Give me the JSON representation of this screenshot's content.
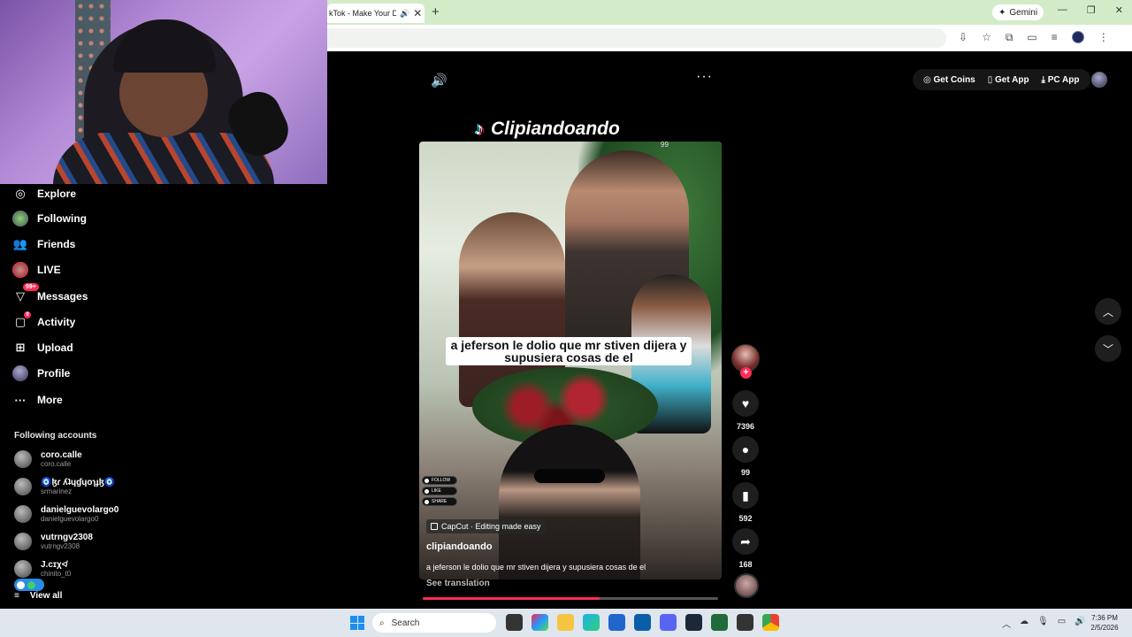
{
  "browser": {
    "tab_title": "kTok - Make Your Da",
    "gemini_label": "Gemini"
  },
  "topbar": {
    "get_coins": "Get Coins",
    "get_app": "Get App",
    "pc_app": "PC App"
  },
  "sidebar": {
    "items": [
      {
        "label": "Explore"
      },
      {
        "label": "Following"
      },
      {
        "label": "Friends"
      },
      {
        "label": "LIVE"
      },
      {
        "label": "Messages",
        "badge": "99+"
      },
      {
        "label": "Activity",
        "badge": "9"
      },
      {
        "label": "Upload"
      },
      {
        "label": "Profile"
      },
      {
        "label": "More"
      }
    ],
    "following_title": "Following accounts",
    "accounts": [
      {
        "name": "coro.calle",
        "username": "coro.calle"
      },
      {
        "name": "🧿ɮɾ ʎʇɥɠɥoɿɟɮ🧿",
        "username": "srmarinez"
      },
      {
        "name": "danielguevolargo0",
        "username": "danielguevolargo0"
      },
      {
        "name": "vutrngv2308",
        "username": "vutrngv2308"
      },
      {
        "name": "J.cɪχ≮",
        "username": "chinito_t0"
      }
    ],
    "view_all": "View all"
  },
  "video": {
    "watermark": "Clipiandoando",
    "top_count": "99",
    "caption": "a jeferson le dolio que mr stiven dijera y supusiera cosas de el",
    "mini_buttons": [
      "FOLLOW",
      "LIKE",
      "SHARE"
    ],
    "capcut_label": "CapCut · Editing made easy",
    "author": "clipiandoando",
    "description": "a jeferson le dolio que mr stiven dijera y supusiera cosas de el",
    "see_translation": "See translation",
    "progress": 0.6
  },
  "actions": {
    "likes": "7396",
    "comments": "99",
    "saves": "592",
    "shares": "168"
  },
  "taskbar": {
    "search_placeholder": "Search",
    "time": "7:36 PM",
    "date": "2/5/2026"
  },
  "colors": {
    "accent": "#fe2c55",
    "tabbar": "#d3ecc7"
  }
}
